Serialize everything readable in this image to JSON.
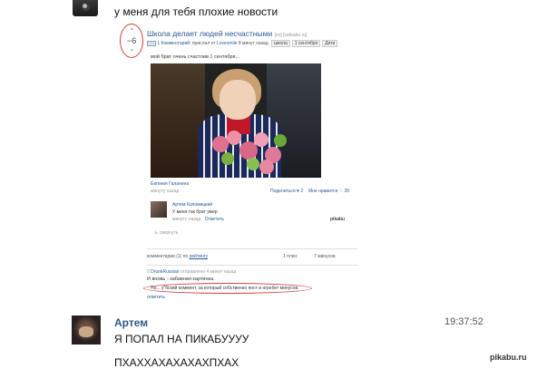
{
  "top_message": {
    "text": "у меня для тебя плохие новости"
  },
  "embedded_post": {
    "rating": "−6",
    "rating_up": "▲",
    "rating_down": "▼",
    "title": "Школа делает людей несчастными",
    "title_tag": "[ex] [safeabu.ru]",
    "meta_comments": "1 Комментарий",
    "meta_text": ": прислал от",
    "meta_author": "Lovesmile",
    "meta_time": "8 минут назад",
    "tags": [
      "школа",
      "1 сентября",
      "Дети"
    ],
    "caption": "мой брат очень счастлив 1 сентября...",
    "photo_user": "Евгения Галанина",
    "photo_time": "минуту назад",
    "share": "Поделиться ♥ 2",
    "likes": "Мне нравится ♡ 20",
    "comment": {
      "name": "Артем Коломицкий",
      "text": "У меня так брат умер",
      "time": "минуту назад ·",
      "reply": "Ответить",
      "logo": "pikabu"
    },
    "collapse": "↳ свернуть",
    "comments_count": "комментарии (1) по",
    "comments_sort": "рейтингу",
    "plus_count": "1 плюс",
    "minus_count": "7 минусов",
    "reply_head_rating": "0",
    "reply_head_user": "DrunkRussian",
    "reply_head_text": "отправлено 4 минут назад",
    "reply_line1": "И вновь - забавная картинка.",
    "reply_line2": "Но... у\"бский коммент, за который собственно пост и огребет минусов.",
    "reply_link": "ответить"
  },
  "second_message": {
    "name": "Артем",
    "time": "19:37:52",
    "line1": "Я ПОПАЛ НА ПИКАБУУУУ",
    "line2": "ПХАХХАХАХАХАХПХАХ"
  },
  "watermark": "pikabu.ru",
  "colors": {
    "accent": "#2c5a8c",
    "highlight_oval": "#d04040"
  }
}
